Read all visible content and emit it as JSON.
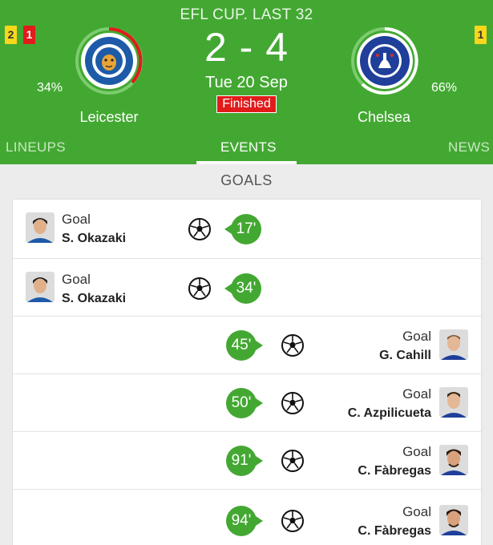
{
  "header": {
    "competition": "EFL CUP. LAST 32",
    "score": "2 - 4",
    "date": "Tue 20 Sep",
    "status": "Finished",
    "home": {
      "name": "Leicester",
      "possession": "34%",
      "yellow_cards": "2",
      "red_cards": "1",
      "logo": "leicester-city-crest"
    },
    "away": {
      "name": "Chelsea",
      "possession": "66%",
      "yellow_cards": "1",
      "logo": "chelsea-crest"
    },
    "colors": {
      "header_bg": "#43a832",
      "red_card": "#e11b1b",
      "yellow_card": "#f8d71c"
    }
  },
  "tabs": [
    {
      "label": "LINEUPS",
      "active": false
    },
    {
      "label": "EVENTS",
      "active": true
    },
    {
      "label": "NEWS",
      "active": false
    }
  ],
  "section_title": "GOALS",
  "events": [
    {
      "side": "home",
      "type": "Goal",
      "player": "S. Okazaki",
      "minute": "17'",
      "icon": "soccer-ball-icon"
    },
    {
      "side": "home",
      "type": "Goal",
      "player": "S. Okazaki",
      "minute": "34'",
      "icon": "soccer-ball-icon"
    },
    {
      "side": "away",
      "type": "Goal",
      "player": "G. Cahill",
      "minute": "45'",
      "icon": "soccer-ball-icon"
    },
    {
      "side": "away",
      "type": "Goal",
      "player": "C. Azpilicueta",
      "minute": "50'",
      "icon": "soccer-ball-icon"
    },
    {
      "side": "away",
      "type": "Goal",
      "player": "C. Fàbregas",
      "minute": "91'",
      "icon": "soccer-ball-icon"
    },
    {
      "side": "away",
      "type": "Goal",
      "player": "C. Fàbregas",
      "minute": "94'",
      "icon": "soccer-ball-icon"
    }
  ]
}
